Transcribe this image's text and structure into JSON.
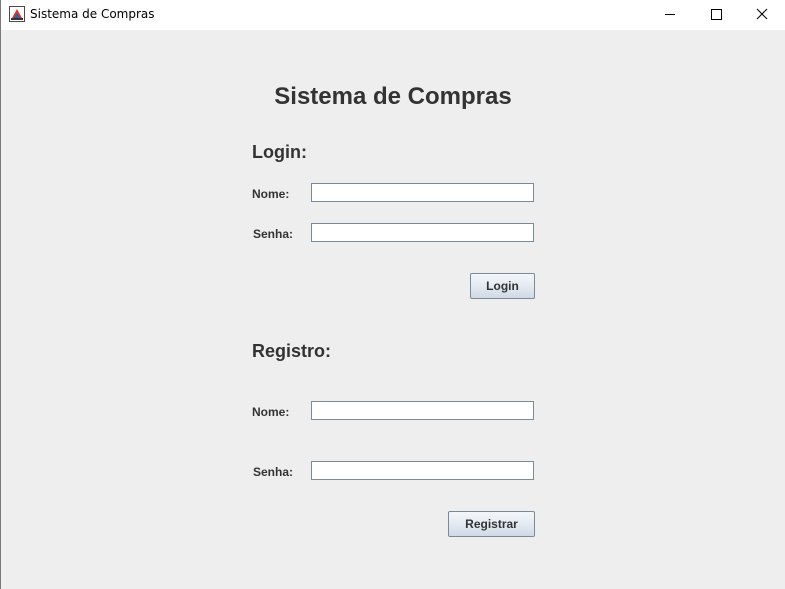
{
  "window": {
    "title": "Sistema de Compras",
    "icons": {
      "app": "java-app-icon",
      "minimize": "minimize-icon",
      "maximize": "maximize-icon",
      "close": "close-icon"
    }
  },
  "main": {
    "title": "Sistema de Compras",
    "login": {
      "section_title": "Login:",
      "name_label": "Nome:",
      "name_value": "",
      "password_label": "Senha:",
      "password_value": "",
      "button_label": "Login"
    },
    "register": {
      "section_title": "Registro:",
      "name_label": "Nome:",
      "name_value": "",
      "password_label": "Senha:",
      "password_value": "",
      "button_label": "Registrar"
    }
  },
  "colors": {
    "background": "#eeeeee",
    "text": "#333333",
    "field_border": "#7a8a99"
  }
}
